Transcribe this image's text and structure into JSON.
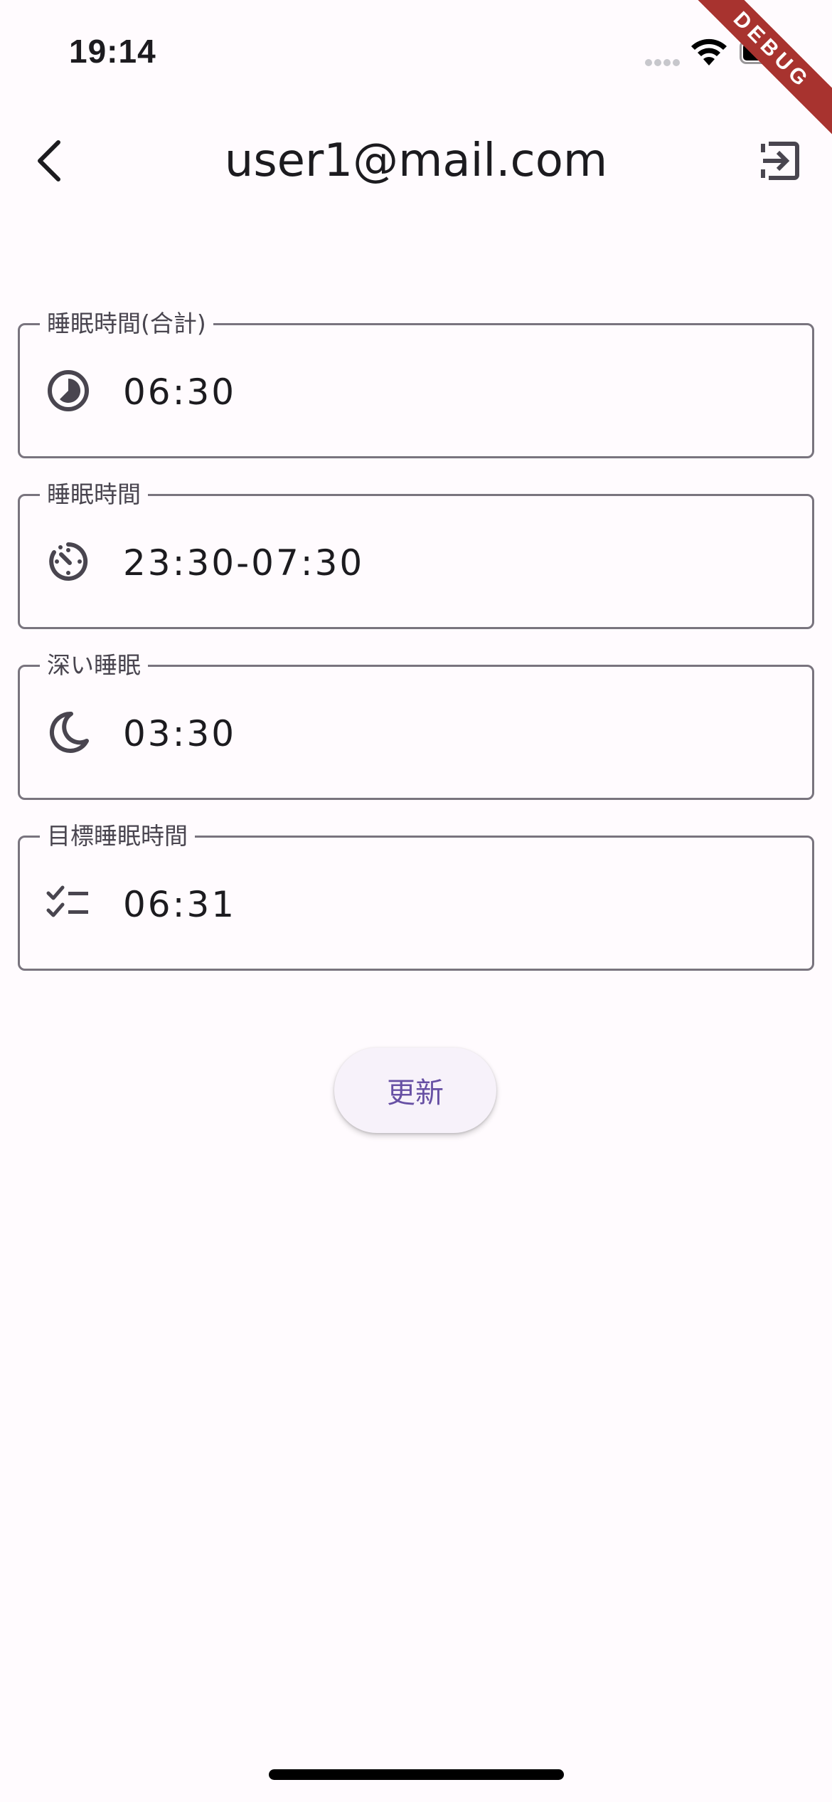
{
  "status_bar": {
    "time": "19:14"
  },
  "debug_banner": "DEBUG",
  "app_bar": {
    "title": "user1@mail.com",
    "back_icon": "chevron-left-icon",
    "logout_icon": "logout-icon"
  },
  "fields": [
    {
      "label": "睡眠時間(合計)",
      "value": "06:30",
      "icon": "clock-icon"
    },
    {
      "label": "睡眠時間",
      "value": "23:30-07:30",
      "icon": "timelapse-icon"
    },
    {
      "label": "深い睡眠",
      "value": "03:30",
      "icon": "moon-icon"
    },
    {
      "label": "目標睡眠時間",
      "value": "06:31",
      "icon": "checklist-icon"
    }
  ],
  "update_button": {
    "label": "更新"
  },
  "colors": {
    "background": "#fffbfe",
    "border": "#79747e",
    "primary": "#6750a4",
    "debug_banner": "#a8332f"
  }
}
